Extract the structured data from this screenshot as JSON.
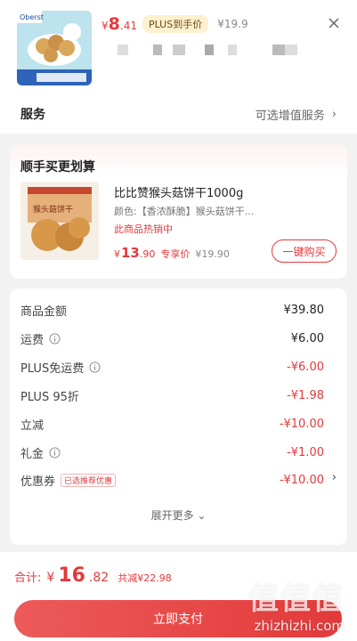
{
  "product": {
    "brand_badge": "Oberst",
    "price_yen": "¥",
    "price_int": "8",
    "price_dec": ".41",
    "plus_tag": "PLUS到手价",
    "orig_price": "¥19.9"
  },
  "service": {
    "title": "服务",
    "right_text": "可选增值服务",
    "arrow": "›"
  },
  "bundle": {
    "title": "顺手买更划算",
    "name": "比比赞猴头菇饼干1000g",
    "spec": "颜色:【香浓酥脆】猴头菇饼干...",
    "hot": "此商品热销中",
    "price_yen": "¥",
    "price_int": "13",
    "price_dec": ".90",
    "price_label": "专享价",
    "orig_price": "¥19.90",
    "buy_label": "一键购买",
    "box_text": "猴头菇饼干"
  },
  "summary": {
    "rows": [
      {
        "label": "商品金额",
        "value": "¥39.80"
      },
      {
        "label": "运费",
        "value": "¥6.00"
      },
      {
        "label": "PLUS免运费",
        "value": "-¥6.00"
      },
      {
        "label": "PLUS 95折",
        "value": "-¥1.98"
      },
      {
        "label": "立减",
        "value": "-¥10.00"
      },
      {
        "label": "礼金",
        "value": "-¥1.00"
      },
      {
        "label": "优惠券",
        "value": "-¥10.00",
        "badge": "已选推荐优惠"
      }
    ],
    "expand": "展开更多 ⌄",
    "row_arrow": "›"
  },
  "bottom": {
    "total_label": "合计:",
    "total_yen": "¥",
    "total_int": "16",
    "total_dec": ".82",
    "saved": "共减¥22.98",
    "pay_label": "立即支付"
  },
  "watermark": {
    "big": "值值值",
    "small": "zhizhizhi.com"
  },
  "colors": {
    "accent": "#e4393c",
    "plus_tag_bg": "#fdf1cf"
  },
  "icons": [
    "close-icon",
    "info-icon",
    "chevron-right-icon"
  ]
}
